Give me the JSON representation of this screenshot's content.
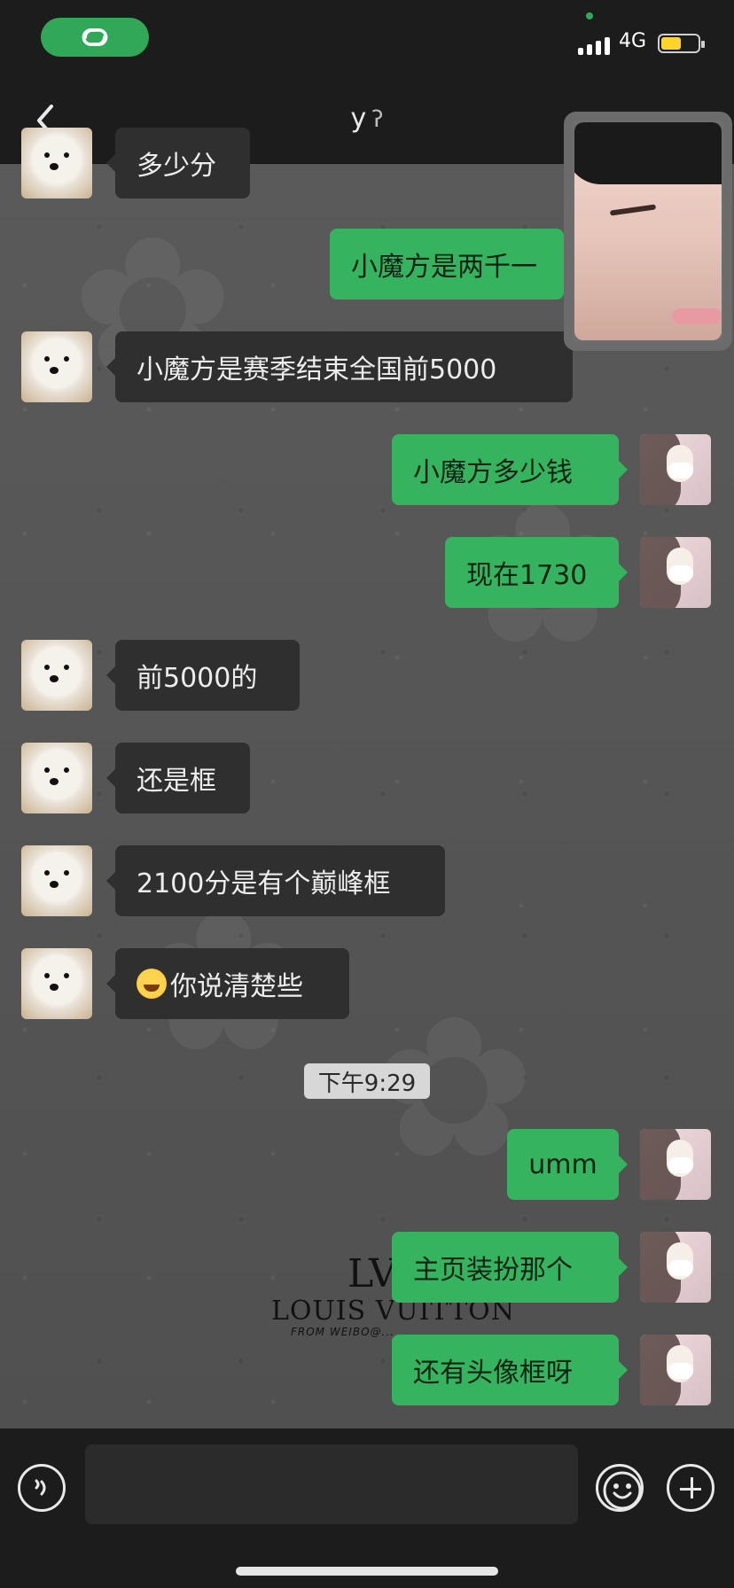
{
  "status_bar": {
    "network": "4G"
  },
  "header": {
    "title": "y",
    "back_label": "<",
    "ear_icon": "ear-icon"
  },
  "messages": {
    "partial_top": "多少分",
    "m1_right": "小魔方是两千一",
    "m2_left": "小魔方是赛季结束全国前5000",
    "m3_right": "小魔方多少钱",
    "m4_right": "现在1730",
    "m5_left": "前5000的",
    "m6_left": "还是框",
    "m7_left": "2100分是有个巅峰框",
    "m8_left": "你说清楚些",
    "timestamp": "下午9:29",
    "m9_right": "umm",
    "m10_right": "主页装扮那个",
    "m11_right": "还有头像框呀"
  },
  "watermark": {
    "logo_text": "LV",
    "brand": "LOUIS VUITTON",
    "sub": "FROM WEIBO@..."
  },
  "input": {
    "placeholder": ""
  },
  "colors": {
    "green_bubble": "#35b35f",
    "dark_bubble": "#2f2f2f",
    "bar_bg": "#1c1c1c"
  }
}
